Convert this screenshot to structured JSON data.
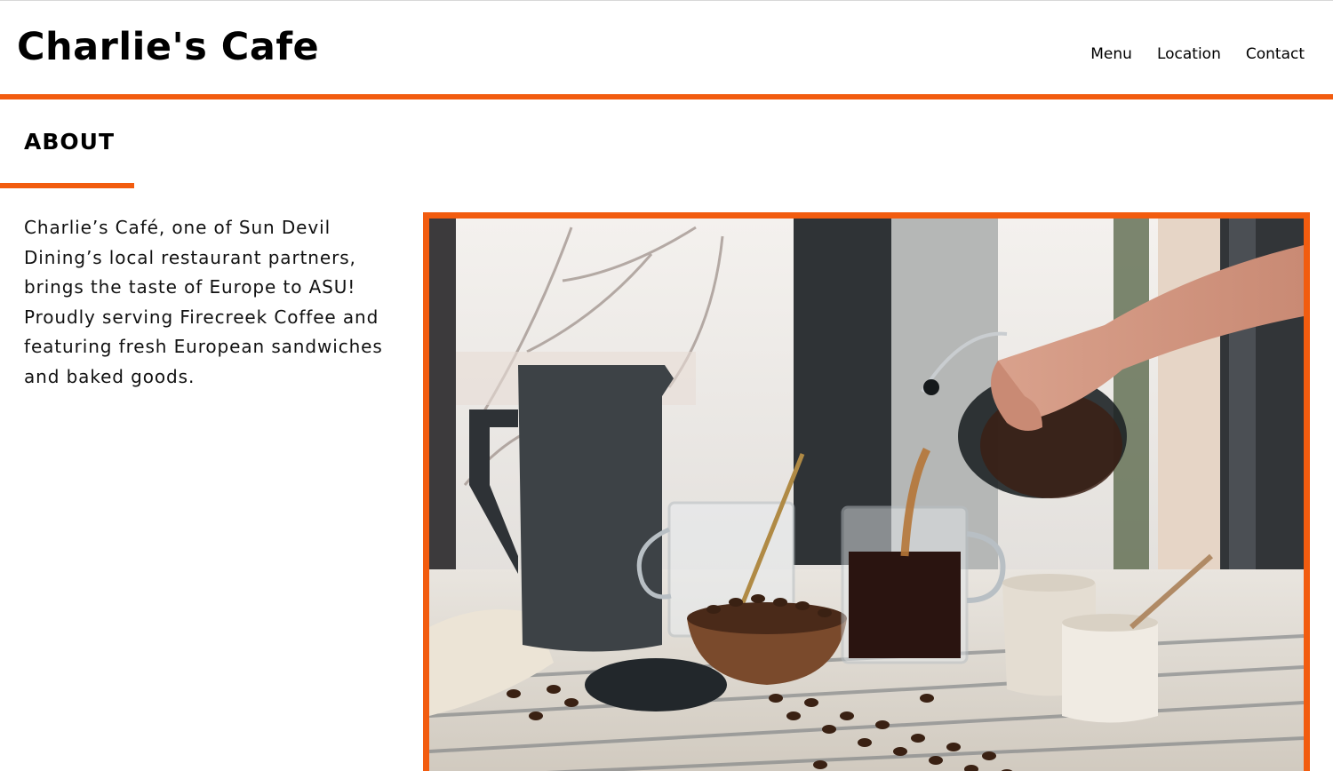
{
  "site": {
    "brand": "Charlie's Cafe"
  },
  "nav": {
    "items": [
      "Menu",
      "Location",
      "Contact"
    ]
  },
  "about": {
    "heading": "ABOUT",
    "body": "Charlie’s Café, one of Sun Devil Dining’s local restaurant partners, brings the taste of Europe to ASU! Proudly serving Firecreek Coffee and featuring fresh European sandwiches and baked goods."
  },
  "photo": {
    "subject": "coffee being poured from a glass carafe into a mug on a table with coffee beans, a jug, cups and a bowl"
  },
  "colors": {
    "accent": "#f25c0f",
    "text": "#000000",
    "background": "#ffffff"
  }
}
